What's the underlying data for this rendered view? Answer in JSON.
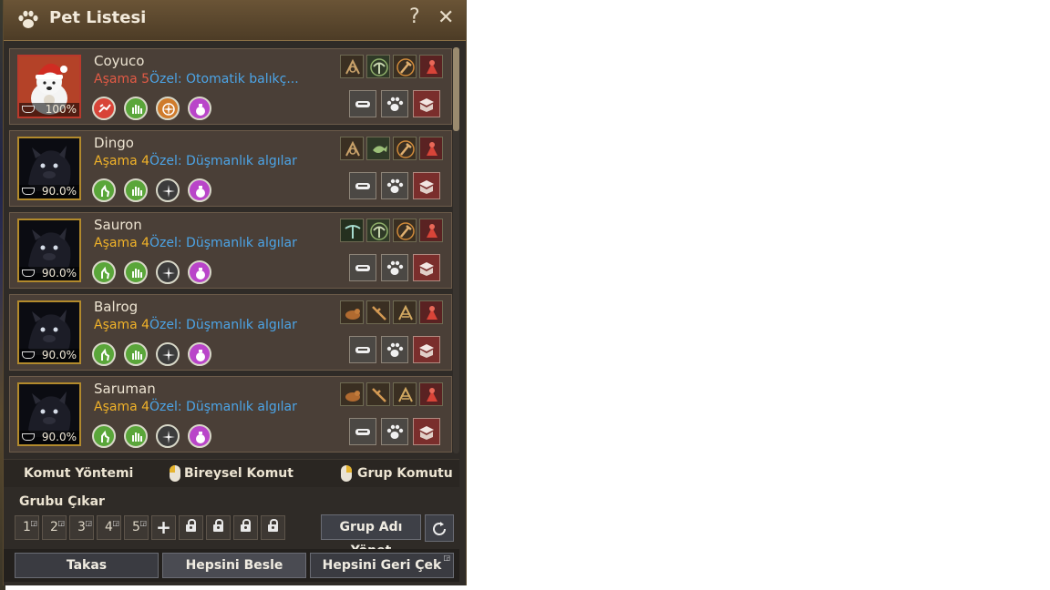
{
  "window": {
    "title": "Pet Listesi",
    "help_symbol": "?",
    "close_symbol": "✕"
  },
  "pets": [
    {
      "name": "Coyuco",
      "tier_label": "Aşama",
      "tier": "5",
      "special": "Özel: Otomatik balıkç...",
      "hunger": "100%",
      "portrait": "polar-bear-with-santa-hat",
      "skills": [
        "red-pet-skill-icon",
        "green-hand-skill-icon",
        "orange-compass-skill-icon",
        "pink-bag-skill-icon"
      ],
      "tools": [
        "gathering-tool-icon",
        "pickaxe-tool-icon",
        "axe-tool-icon",
        "red-talent-tool-icon"
      ]
    },
    {
      "name": "Dingo",
      "tier_label": "Aşama",
      "tier": "4",
      "special": "Özel: Düşmanlık algılar",
      "hunger": "90.0%",
      "portrait": "black-hound",
      "skills": [
        "green-cat-skill-icon",
        "green-hand-skill-icon",
        "gray-compass-skill-icon",
        "pink-bag-skill-icon"
      ],
      "tools": [
        "gathering-tool-icon",
        "fish-tool-icon",
        "axe-tool-icon",
        "red-talent-tool-icon"
      ]
    },
    {
      "name": "Sauron",
      "tier_label": "Aşama",
      "tier": "4",
      "special": "Özel: Düşmanlık algılar",
      "hunger": "90.0%",
      "portrait": "black-hound",
      "skills": [
        "green-cat-skill-icon",
        "green-hand-skill-icon",
        "gray-compass-skill-icon",
        "pink-bag-skill-icon"
      ],
      "tools": [
        "pickaxe-tool-icon",
        "pickaxe-tool-icon",
        "axe-tool-icon",
        "red-talent-tool-icon"
      ]
    },
    {
      "name": "Balrog",
      "tier_label": "Aşama",
      "tier": "4",
      "special": "Özel: Düşmanlık algılar",
      "hunger": "90.0%",
      "portrait": "black-hound",
      "skills": [
        "green-cat-skill-icon",
        "green-hand-skill-icon",
        "gray-compass-skill-icon",
        "pink-bag-skill-icon"
      ],
      "tools": [
        "hide-tool-icon",
        "sickle-tool-icon",
        "gathering-tool-icon",
        "red-talent-tool-icon"
      ]
    },
    {
      "name": "Saruman",
      "tier_label": "Aşama",
      "tier": "4",
      "special": "Özel: Düşmanlık algılar",
      "hunger": "90.0%",
      "portrait": "black-hound",
      "skills": [
        "green-cat-skill-icon",
        "green-hand-skill-icon",
        "gray-compass-skill-icon",
        "pink-bag-skill-icon"
      ],
      "tools": [
        "hide-tool-icon",
        "sickle-tool-icon",
        "gathering-tool-icon",
        "red-talent-tool-icon"
      ]
    }
  ],
  "command": {
    "label": "Komut Yöntemi",
    "individual": "Bireysel Komut",
    "group": "Grup Komutu"
  },
  "group": {
    "remove_label": "Grubu Çıkar",
    "slots": [
      "1",
      "2",
      "3",
      "4",
      "5"
    ],
    "add_symbol": "+",
    "manage_name": "Grup Adı Yönet"
  },
  "buttons": {
    "trade": "Takas",
    "feed_all": "Hepsini Besle",
    "recall_all": "Hepsini Geri Çek"
  },
  "colors": {
    "tier_5": "#e25a45",
    "tier_4": "#f0b229",
    "special_text": "#4ca4e6",
    "portrait_frame": "#b28a2c"
  }
}
